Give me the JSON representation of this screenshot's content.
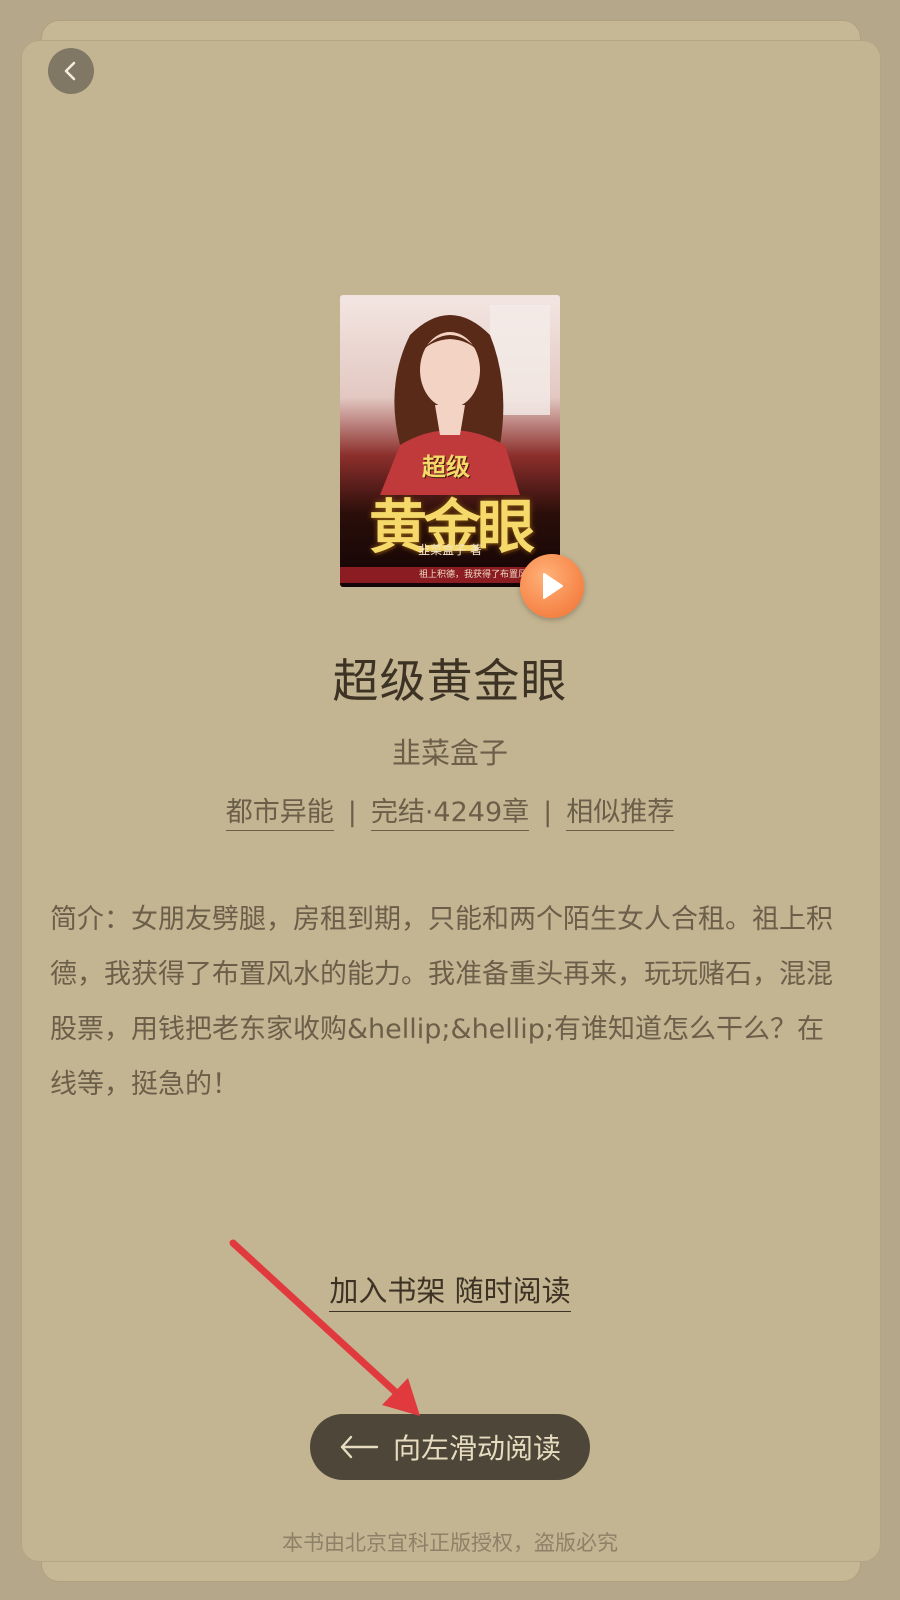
{
  "book": {
    "title": "超级黄金眼",
    "author": "韭菜盒子",
    "cover": {
      "small_title": "超级",
      "big_title": "黄金眼",
      "author_line": "韭菜盒子 著",
      "tagline": "祖上积德，我获得了布置风水的能"
    },
    "meta": {
      "category": "都市异能",
      "status": "完结·4249章",
      "similar": "相似推荐",
      "separator": "|"
    },
    "intro": "简介：女朋友劈腿，房租到期，只能和两个陌生女人合租。祖上积德，我获得了布置风水的能力。我准备重头再来，玩玩赌石，混混股票，用钱把老东家收购&hellip;&hellip;有谁知道怎么干么？在线等，挺急的！"
  },
  "actions": {
    "add_shelf": "加入书架 随时阅读",
    "swipe_read": "向左滑动阅读"
  },
  "footer": "本书由北京宜科正版授权，盗版必究",
  "icons": {
    "back": "chevron-left-icon",
    "play": "play-icon",
    "swipe": "arrow-left-icon"
  },
  "colors": {
    "background": "#b5a88a",
    "card": "#c4b592",
    "button_dark": "#4e4638",
    "play_orange": "#f26f30",
    "annotation_arrow": "#e03a3e"
  }
}
